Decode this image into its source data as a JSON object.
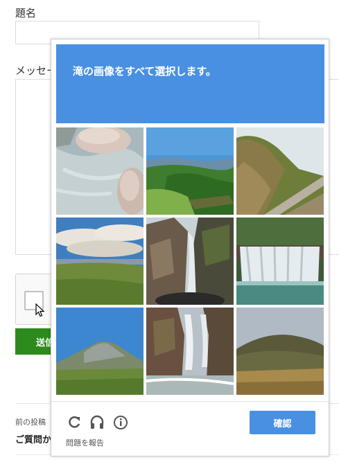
{
  "form": {
    "subject_label": "題名",
    "message_label": "メッセージ",
    "send_label": "送信",
    "prev_post_label": "前の投稿",
    "prev_post_title": "ご質問から"
  },
  "captcha": {
    "title_keyword": "滝",
    "title_rest": "の画像をすべて選択します。",
    "verify_label": "確認",
    "report_label": "問題を報告",
    "header_color": "#4a90e2",
    "tiles": [
      {
        "name": "tile-rocks-stream"
      },
      {
        "name": "tile-green-hills"
      },
      {
        "name": "tile-mountain-road"
      },
      {
        "name": "tile-cloudy-meadow"
      },
      {
        "name": "tile-waterfall-cliff"
      },
      {
        "name": "tile-wide-waterfall"
      },
      {
        "name": "tile-mountain-peak"
      },
      {
        "name": "tile-canyon-waterfall"
      },
      {
        "name": "tile-grassy-hill"
      }
    ],
    "footer_icons": [
      "reload-icon",
      "headphones-icon",
      "info-icon"
    ]
  },
  "colors": {
    "send_button": "#2c8b1c",
    "verify_button": "#4a90e2"
  }
}
